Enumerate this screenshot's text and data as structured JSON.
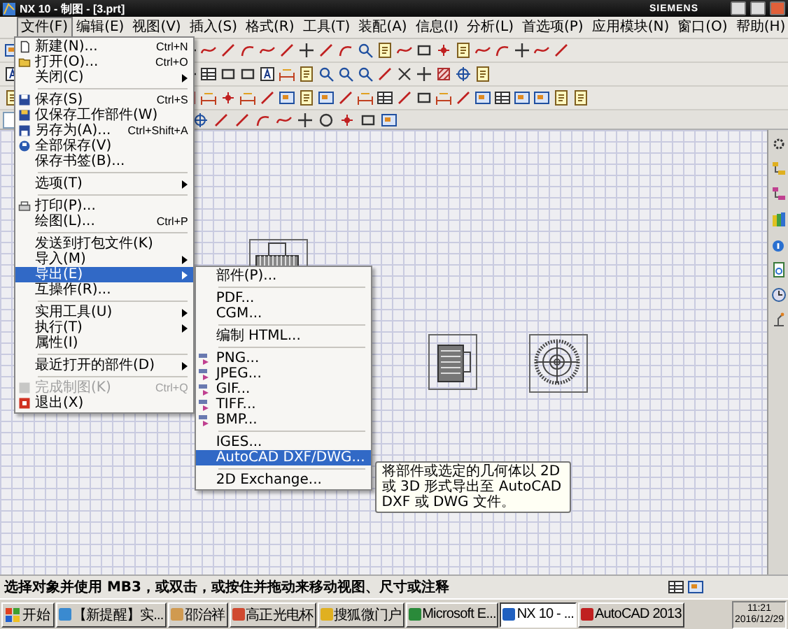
{
  "window": {
    "title": "NX 10 - 制图 - [3.prt]",
    "brand": "SIEMENS"
  },
  "menu_bar": [
    {
      "label": "文件(F)",
      "selected": true
    },
    {
      "label": "编辑(E)",
      "selected": false
    },
    {
      "label": "视图(V)",
      "selected": false
    },
    {
      "label": "插入(S)",
      "selected": false
    },
    {
      "label": "格式(R)",
      "selected": false
    },
    {
      "label": "工具(T)",
      "selected": false
    },
    {
      "label": "装配(A)",
      "selected": false
    },
    {
      "label": "信息(I)",
      "selected": false
    },
    {
      "label": "分析(L)",
      "selected": false
    },
    {
      "label": "首选项(P)",
      "selected": false
    },
    {
      "label": "应用模块(N)",
      "selected": false
    },
    {
      "label": "窗口(O)",
      "selected": false
    },
    {
      "label": "帮助(H)",
      "selected": false
    }
  ],
  "file_menu": [
    {
      "kind": "item",
      "label": "新建(N)...",
      "shortcut": "Ctrl+N",
      "submenu": false,
      "selected": false,
      "disabled": false
    },
    {
      "kind": "item",
      "label": "打开(O)...",
      "shortcut": "Ctrl+O",
      "submenu": false,
      "selected": false,
      "disabled": false
    },
    {
      "kind": "item",
      "label": "关闭(C)",
      "submenu": true,
      "selected": false,
      "disabled": false
    },
    {
      "kind": "separator"
    },
    {
      "kind": "item",
      "label": "保存(S)",
      "shortcut": "Ctrl+S",
      "submenu": false,
      "selected": false,
      "disabled": false
    },
    {
      "kind": "item",
      "label": "仅保存工作部件(W)",
      "submenu": false,
      "selected": false,
      "disabled": false
    },
    {
      "kind": "item",
      "label": "另存为(A)...",
      "shortcut": "Ctrl+Shift+A",
      "submenu": false,
      "selected": false,
      "disabled": false
    },
    {
      "kind": "item",
      "label": "全部保存(V)",
      "submenu": false,
      "selected": false,
      "disabled": false
    },
    {
      "kind": "item",
      "label": "保存书签(B)...",
      "submenu": false,
      "selected": false,
      "disabled": false
    },
    {
      "kind": "separator"
    },
    {
      "kind": "item",
      "label": "选项(T)",
      "submenu": true,
      "selected": false,
      "disabled": false
    },
    {
      "kind": "separator"
    },
    {
      "kind": "item",
      "label": "打印(P)...",
      "submenu": false,
      "selected": false,
      "disabled": false
    },
    {
      "kind": "item",
      "label": "绘图(L)...",
      "shortcut": "Ctrl+P",
      "submenu": false,
      "selected": false,
      "disabled": false
    },
    {
      "kind": "separator"
    },
    {
      "kind": "item",
      "label": "发送到打包文件(K)",
      "submenu": false,
      "selected": false,
      "disabled": false
    },
    {
      "kind": "item",
      "label": "导入(M)",
      "submenu": true,
      "selected": false,
      "disabled": false
    },
    {
      "kind": "item",
      "label": "导出(E)",
      "submenu": true,
      "selected": true,
      "disabled": false
    },
    {
      "kind": "item",
      "label": "互操作(R)...",
      "submenu": false,
      "selected": false,
      "disabled": false
    },
    {
      "kind": "separator"
    },
    {
      "kind": "item",
      "label": "实用工具(U)",
      "submenu": true,
      "selected": false,
      "disabled": false
    },
    {
      "kind": "item",
      "label": "执行(T)",
      "submenu": true,
      "selected": false,
      "disabled": false
    },
    {
      "kind": "item",
      "label": "属性(I)",
      "submenu": false,
      "selected": false,
      "disabled": false
    },
    {
      "kind": "separator"
    },
    {
      "kind": "item",
      "label": "最近打开的部件(D)",
      "submenu": true,
      "selected": false,
      "disabled": false
    },
    {
      "kind": "separator"
    },
    {
      "kind": "item",
      "label": "完成制图(K)",
      "shortcut": "Ctrl+Q",
      "submenu": false,
      "selected": false,
      "disabled": true
    },
    {
      "kind": "item",
      "label": "退出(X)",
      "submenu": false,
      "selected": false,
      "disabled": false
    }
  ],
  "export_submenu": [
    {
      "kind": "item",
      "label": "部件(P)...",
      "selected": false
    },
    {
      "kind": "separator"
    },
    {
      "kind": "item",
      "label": "PDF...",
      "selected": false
    },
    {
      "kind": "item",
      "label": "CGM...",
      "selected": false
    },
    {
      "kind": "separator"
    },
    {
      "kind": "item",
      "label": "编制 HTML...",
      "selected": false
    },
    {
      "kind": "separator"
    },
    {
      "kind": "item",
      "label": "PNG...",
      "selected": false
    },
    {
      "kind": "item",
      "label": "JPEG...",
      "selected": false
    },
    {
      "kind": "item",
      "label": "GIF...",
      "selected": false
    },
    {
      "kind": "item",
      "label": "TIFF...",
      "selected": false
    },
    {
      "kind": "item",
      "label": "BMP...",
      "selected": false
    },
    {
      "kind": "separator"
    },
    {
      "kind": "item",
      "label": "IGES...",
      "selected": false
    },
    {
      "kind": "item",
      "label": "AutoCAD DXF/DWG...",
      "selected": true
    },
    {
      "kind": "separator"
    },
    {
      "kind": "item",
      "label": "2D Exchange...",
      "selected": false
    }
  ],
  "tooltip": "将部件或选定的几何体以 2D 或 3D 形式导出至 AutoCAD DXF 或 DWG 文件。",
  "status_bar": {
    "prompt": "选择对象并使用 MB3，或双击，或按住并拖动来移动视图、尺寸或注释"
  },
  "taskbar": {
    "start": "开始",
    "tasks": [
      {
        "label": "【新提醒】实...",
        "selected": false
      },
      {
        "label": "邵治祥",
        "selected": false
      },
      {
        "label": "高正光电杯",
        "selected": false
      },
      {
        "label": "搜狐微门户",
        "selected": false
      },
      {
        "label": "Microsoft E...",
        "selected": false
      },
      {
        "label": "NX 10 - ...",
        "selected": true
      },
      {
        "label": "AutoCAD 2013",
        "selected": false
      }
    ],
    "time": "11:21",
    "date": "2016/12/29"
  }
}
